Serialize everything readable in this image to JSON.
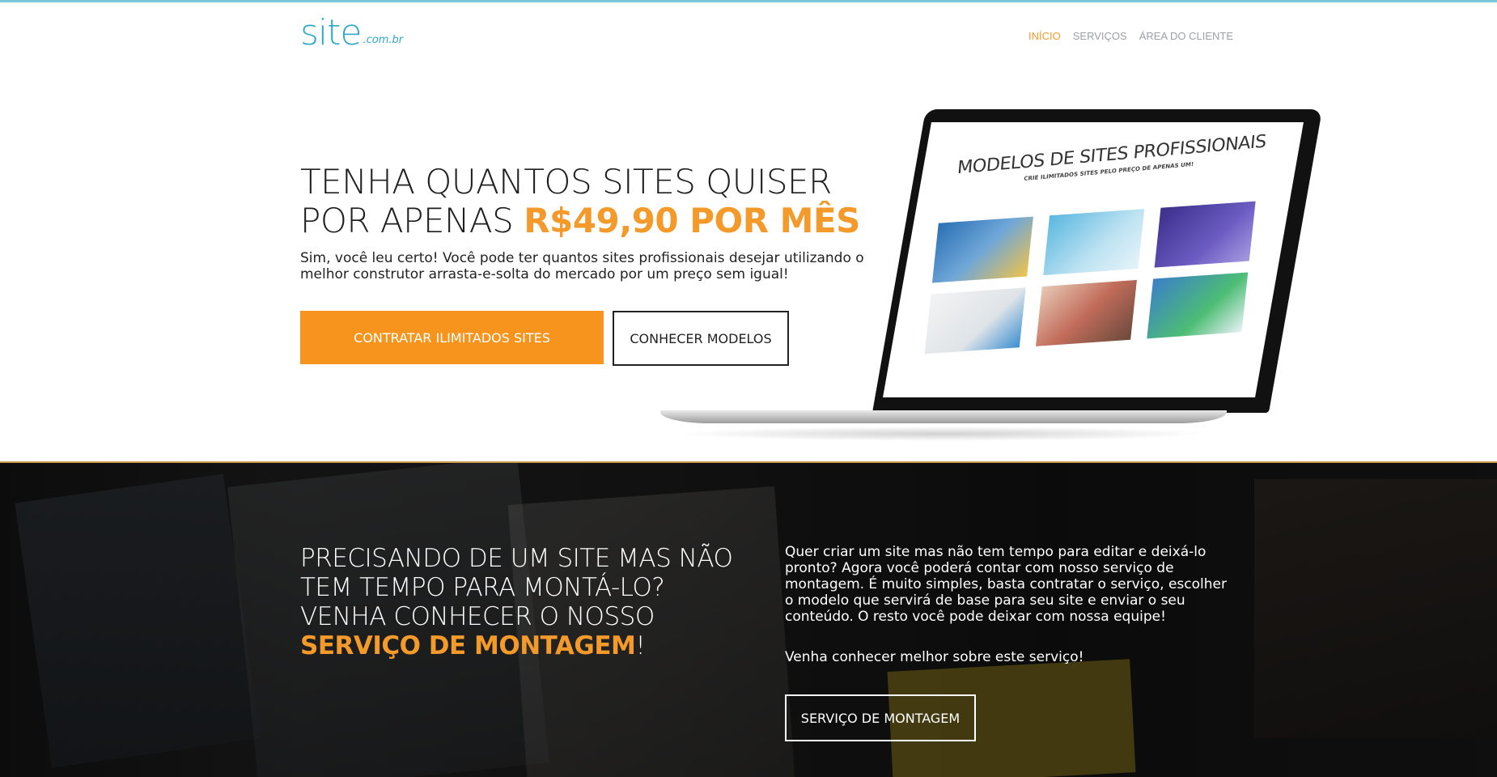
{
  "header": {
    "logo_main": "site",
    "logo_sub": ".com.br",
    "nav": [
      {
        "label": "Início"
      },
      {
        "label": "Serviços"
      },
      {
        "label": "Área do Cliente"
      }
    ]
  },
  "hero": {
    "title_part1": "TENHA QUANTOS SITES QUISER POR APENAS ",
    "title_highlight": "R$49,90 POR MÊS",
    "description": "Sim, você leu certo! Você pode ter quantos sites profissionais desejar utilizando o melhor construtor arrasta-e-solta do mercado por um preço sem igual!",
    "primary_button": "CONTRATAR ILIMITADOS SITES",
    "secondary_button": "CONHECER MODELOS",
    "laptop_screen_title": "MODELOS DE SITES PROFISSIONAIS",
    "laptop_screen_subtitle": "CRIE ILIMITADOS SITES PELO PREÇO DE APENAS UM!"
  },
  "service": {
    "title_line1": "PRECISANDO DE UM SITE MAS NÃO TEM TEMPO PARA MONTÁ-LO? VENHA CONHECER O NOSSO ",
    "title_highlight": "SERVIÇO DE MONTAGEM",
    "title_end": "!",
    "text": "Quer criar um site mas não tem tempo para editar e deixá-lo pronto? Agora você poderá contar com nosso serviço de montagem. É muito simples, basta contratar o serviço, escolher o modelo que servirá de base para seu site e enviar o seu conteúdo. O resto você pode deixar com nossa equipe!",
    "text2": "Venha conhecer melhor sobre este serviço!",
    "button": "SERVIÇO DE MONTAGEM"
  },
  "colors": {
    "accent": "#f39a2b",
    "brand": "#2fa9c8"
  }
}
